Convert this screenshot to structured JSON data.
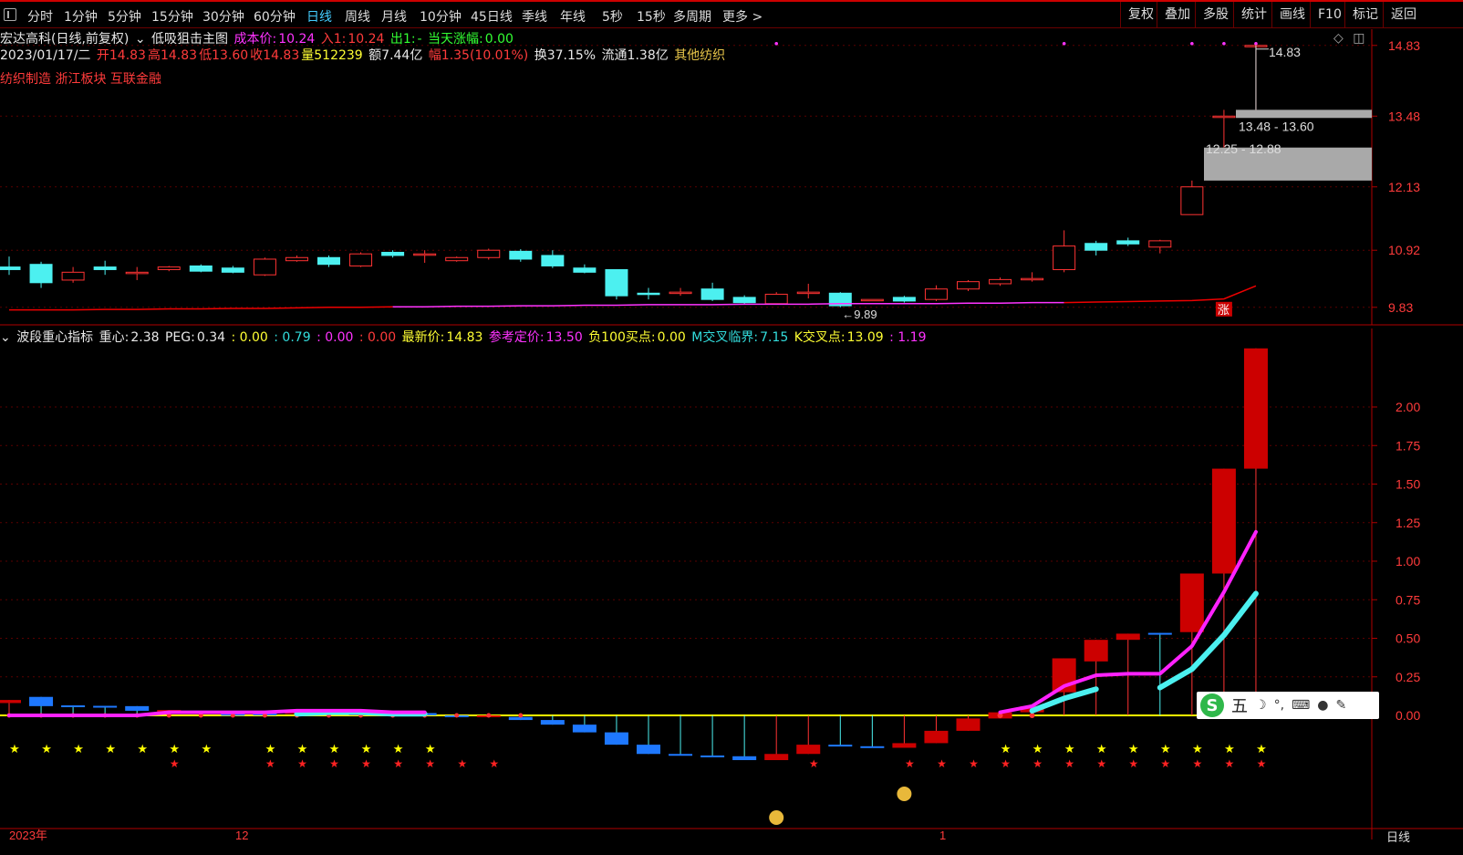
{
  "toolbar": {
    "items": [
      "分时",
      "1分钟",
      "5分钟",
      "15分钟",
      "30分钟",
      "60分钟",
      "日线",
      "周线",
      "月线",
      "10分钟",
      "45日线",
      "季线",
      "年线",
      "5秒",
      "15秒",
      "多周期",
      "更多 >"
    ],
    "active_index": 6,
    "right_items": [
      "复权",
      "叠加",
      "多股",
      "统计",
      "画线",
      "F10",
      "标记",
      "返回"
    ]
  },
  "upper_info": {
    "stock_name": "宏达高科(日线,前复权)",
    "indicator_name": "低吸狙击主图",
    "cost_label": "成本价:",
    "cost_value": "10.24",
    "in_label": "入1:",
    "in_value": "10.24",
    "out_label": "出1:",
    "out_value": "-",
    "today_change_label": "当天涨幅:",
    "today_change_value": "0.00",
    "line2": {
      "date": "2023/01/17/二",
      "open": "开14.83",
      "high": "高14.83",
      "low": "低13.60",
      "close": "收14.83",
      "volume": "量512239",
      "amount": "额7.44亿",
      "change": "幅1.35(10.01%)",
      "turnover": "换37.15%",
      "float": "流通1.38亿",
      "sector": "其他纺织"
    },
    "tags": "纺织制造 浙江板块 互联金融"
  },
  "upper_axis": [
    "14.83",
    "13.48",
    "12.13",
    "10.92",
    "9.83"
  ],
  "upper_annotations": {
    "high_mark": "14.83",
    "low_mark": "9.89",
    "gap_upper": "13.48 - 13.60",
    "gap_lower": "12.25 - 12.88",
    "limit_up_badge": "涨"
  },
  "lower_info": {
    "indicator_name": "波段重心指标",
    "center_label": "重心:",
    "center_value": "2.38",
    "peg_label": "PEG:",
    "peg_value": "0.34",
    "v1": ": 0.00",
    "v2": ": 0.79",
    "v3": ": 0.00",
    "v4": ": 0.00",
    "latest_label": "最新价:",
    "latest_value": "14.83",
    "ref_label": "参考定价:",
    "ref_value": "13.50",
    "neg100_label": "负100买点:",
    "neg100_value": "0.00",
    "mcross_label": "M交叉临界:",
    "mcross_value": "7.15",
    "kcross_label": "K交叉点:",
    "kcross_value": "13.09",
    "last_value": ": 1.19"
  },
  "lower_axis": [
    "2.00",
    "1.75",
    "1.50",
    "1.25",
    "1.00",
    "0.75",
    "0.50",
    "0.25",
    "0.00"
  ],
  "bottom_labels": [
    "2023年",
    "12",
    "1"
  ],
  "bottom_right": "日线",
  "ime": {
    "logo": "S",
    "mode": "五"
  },
  "colors": {
    "up": "#ff3333",
    "down": "#4cf0f0",
    "ma": "#ee0000",
    "ma2": "#ff33ff",
    "fill_up": "#cc0000",
    "fill_down": "#1e78ff",
    "zero": "#ffff00"
  },
  "chart_data": [
    {
      "type": "candlestick",
      "title": "宏达高科(日线,前复权)",
      "ylim": [
        9.6,
        15.0
      ],
      "y_ticks": [
        14.83,
        13.48,
        12.13,
        10.92,
        9.83
      ],
      "candles": [
        {
          "o": 10.6,
          "c": 10.55,
          "h": 10.8,
          "l": 10.45
        },
        {
          "o": 10.65,
          "c": 10.3,
          "h": 10.7,
          "l": 10.2
        },
        {
          "o": 10.35,
          "c": 10.5,
          "h": 10.6,
          "l": 10.3
        },
        {
          "o": 10.6,
          "c": 10.55,
          "h": 10.72,
          "l": 10.45
        },
        {
          "o": 10.5,
          "c": 10.5,
          "h": 10.6,
          "l": 10.35
        },
        {
          "o": 10.55,
          "c": 10.6,
          "h": 10.62,
          "l": 10.52
        },
        {
          "o": 10.62,
          "c": 10.52,
          "h": 10.65,
          "l": 10.5
        },
        {
          "o": 10.58,
          "c": 10.5,
          "h": 10.62,
          "l": 10.48
        },
        {
          "o": 10.45,
          "c": 10.75,
          "h": 10.78,
          "l": 10.43
        },
        {
          "o": 10.72,
          "c": 10.78,
          "h": 10.82,
          "l": 10.7
        },
        {
          "o": 10.78,
          "c": 10.65,
          "h": 10.82,
          "l": 10.6
        },
        {
          "o": 10.62,
          "c": 10.85,
          "h": 10.88,
          "l": 10.6
        },
        {
          "o": 10.88,
          "c": 10.82,
          "h": 10.92,
          "l": 10.78
        },
        {
          "o": 10.85,
          "c": 10.85,
          "h": 10.92,
          "l": 10.68
        },
        {
          "o": 10.72,
          "c": 10.78,
          "h": 10.8,
          "l": 10.7
        },
        {
          "o": 10.78,
          "c": 10.92,
          "h": 10.95,
          "l": 10.74
        },
        {
          "o": 10.9,
          "c": 10.75,
          "h": 10.94,
          "l": 10.7
        },
        {
          "o": 10.82,
          "c": 10.62,
          "h": 10.92,
          "l": 10.58
        },
        {
          "o": 10.58,
          "c": 10.5,
          "h": 10.65,
          "l": 10.48
        },
        {
          "o": 10.55,
          "c": 10.05,
          "h": 10.55,
          "l": 9.98
        },
        {
          "o": 10.1,
          "c": 10.08,
          "h": 10.2,
          "l": 9.98
        },
        {
          "o": 10.12,
          "c": 10.12,
          "h": 10.2,
          "l": 10.05
        },
        {
          "o": 10.18,
          "c": 9.98,
          "h": 10.3,
          "l": 9.95
        },
        {
          "o": 10.02,
          "c": 9.92,
          "h": 10.06,
          "l": 9.88
        },
        {
          "o": 9.9,
          "c": 10.08,
          "h": 10.12,
          "l": 9.88
        },
        {
          "o": 10.12,
          "c": 10.12,
          "h": 10.28,
          "l": 10.0
        },
        {
          "o": 10.1,
          "c": 9.86,
          "h": 10.12,
          "l": 9.83
        },
        {
          "o": 9.98,
          "c": 9.98,
          "h": 9.98,
          "l": 9.98
        },
        {
          "o": 10.02,
          "c": 9.95,
          "h": 10.05,
          "l": 9.92
        },
        {
          "o": 9.98,
          "c": 10.18,
          "h": 10.25,
          "l": 9.95
        },
        {
          "o": 10.18,
          "c": 10.32,
          "h": 10.35,
          "l": 10.14
        },
        {
          "o": 10.28,
          "c": 10.36,
          "h": 10.4,
          "l": 10.24
        },
        {
          "o": 10.38,
          "c": 10.38,
          "h": 10.5,
          "l": 10.32
        },
        {
          "o": 10.55,
          "c": 11.0,
          "h": 11.3,
          "l": 10.5
        },
        {
          "o": 11.05,
          "c": 10.92,
          "h": 11.1,
          "l": 10.82
        },
        {
          "o": 11.1,
          "c": 11.04,
          "h": 11.16,
          "l": 11.0
        },
        {
          "o": 10.98,
          "c": 11.1,
          "h": 11.12,
          "l": 10.86
        },
        {
          "o": 11.6,
          "c": 12.13,
          "h": 12.25,
          "l": 11.6
        },
        {
          "o": 13.48,
          "c": 13.48,
          "h": 13.6,
          "l": 12.88
        },
        {
          "o": 14.83,
          "c": 14.83,
          "h": 14.83,
          "l": 13.6
        }
      ],
      "ma": [
        9.78,
        9.78,
        9.78,
        9.79,
        9.79,
        9.8,
        9.8,
        9.81,
        9.81,
        9.82,
        9.83,
        9.83,
        9.84,
        9.84,
        9.85,
        9.85,
        9.86,
        9.86,
        9.87,
        9.87,
        9.88,
        9.88,
        9.88,
        9.89,
        9.89,
        9.89,
        9.9,
        9.9,
        9.9,
        9.9,
        9.91,
        9.91,
        9.92,
        9.92,
        9.93,
        9.94,
        9.95,
        9.96,
        9.99,
        10.24
      ]
    },
    {
      "type": "bar",
      "title": "波段重心指标",
      "ylim": [
        -0.45,
        2.4
      ],
      "y_ticks": [
        2.0,
        1.75,
        1.5,
        1.25,
        1.0,
        0.75,
        0.5,
        0.25,
        0.0
      ],
      "bars": [
        {
          "lo": 0.08,
          "hi": 0.1,
          "up": true
        },
        {
          "lo": 0.06,
          "hi": 0.12,
          "up": false
        },
        {
          "lo": 0.06,
          "hi": 0.065,
          "up": false
        },
        {
          "lo": 0.06,
          "hi": 0.062,
          "up": false
        },
        {
          "lo": 0.03,
          "hi": 0.06,
          "up": false
        },
        {
          "lo": 0.03,
          "hi": 0.035,
          "up": true
        },
        {
          "lo": 0.01,
          "hi": 0.03,
          "up": false
        },
        {
          "lo": 0.0,
          "hi": 0.01,
          "up": false
        },
        {
          "lo": 0.0,
          "hi": 0.02,
          "up": false
        },
        {
          "lo": 0.01,
          "hi": 0.03,
          "up": true
        },
        {
          "lo": 0.01,
          "hi": 0.03,
          "up": false
        },
        {
          "lo": 0.0,
          "hi": 0.02,
          "up": true
        },
        {
          "lo": 0.0,
          "hi": 0.02,
          "up": false
        },
        {
          "lo": 0.0,
          "hi": 0.015,
          "up": false
        },
        {
          "lo": -0.01,
          "hi": 0.0,
          "up": false
        },
        {
          "lo": -0.005,
          "hi": 0.0,
          "up": true
        },
        {
          "lo": -0.03,
          "hi": -0.01,
          "up": false
        },
        {
          "lo": -0.06,
          "hi": -0.03,
          "up": false
        },
        {
          "lo": -0.11,
          "hi": -0.06,
          "up": false
        },
        {
          "lo": -0.19,
          "hi": -0.11,
          "up": false
        },
        {
          "lo": -0.25,
          "hi": -0.19,
          "up": false
        },
        {
          "lo": -0.26,
          "hi": -0.25,
          "up": false
        },
        {
          "lo": -0.265,
          "hi": -0.26,
          "up": false
        },
        {
          "lo": -0.29,
          "hi": -0.265,
          "up": false
        },
        {
          "lo": -0.29,
          "hi": -0.25,
          "up": true
        },
        {
          "lo": -0.25,
          "hi": -0.19,
          "up": true
        },
        {
          "lo": -0.2,
          "hi": -0.19,
          "up": false
        },
        {
          "lo": -0.21,
          "hi": -0.2,
          "up": false
        },
        {
          "lo": -0.21,
          "hi": -0.18,
          "up": true
        },
        {
          "lo": -0.18,
          "hi": -0.1,
          "up": true
        },
        {
          "lo": -0.1,
          "hi": -0.02,
          "up": true
        },
        {
          "lo": -0.02,
          "hi": 0.02,
          "up": true
        },
        {
          "lo": 0.02,
          "hi": 0.06,
          "up": true
        },
        {
          "lo": 0.15,
          "hi": 0.37,
          "up": true
        },
        {
          "lo": 0.35,
          "hi": 0.49,
          "up": true
        },
        {
          "lo": 0.49,
          "hi": 0.53,
          "up": true
        },
        {
          "lo": 0.53,
          "hi": 0.535,
          "up": false
        },
        {
          "lo": 0.54,
          "hi": 0.92,
          "up": true
        },
        {
          "lo": 0.92,
          "hi": 1.6,
          "up": true
        },
        {
          "lo": 1.6,
          "hi": 2.38,
          "up": true
        }
      ],
      "magenta_line": [
        0.0,
        0.0,
        0.0,
        0.0,
        0.0,
        0.02,
        0.02,
        0.02,
        0.02,
        0.03,
        0.03,
        0.03,
        0.02,
        0.02,
        null,
        null,
        null,
        null,
        null,
        null,
        null,
        null,
        null,
        null,
        null,
        null,
        null,
        null,
        null,
        null,
        null,
        0.02,
        0.06,
        0.19,
        0.26,
        0.27,
        0.27,
        0.45,
        0.8,
        1.19
      ],
      "cyan_line": [
        null,
        null,
        null,
        null,
        null,
        null,
        null,
        null,
        null,
        0.01,
        0.02,
        0.02,
        0.01,
        0.01,
        null,
        null,
        null,
        null,
        null,
        null,
        null,
        null,
        null,
        null,
        null,
        null,
        null,
        null,
        null,
        null,
        null,
        null,
        0.03,
        0.11,
        0.17,
        null,
        0.18,
        0.3,
        0.52,
        0.79
      ]
    }
  ]
}
